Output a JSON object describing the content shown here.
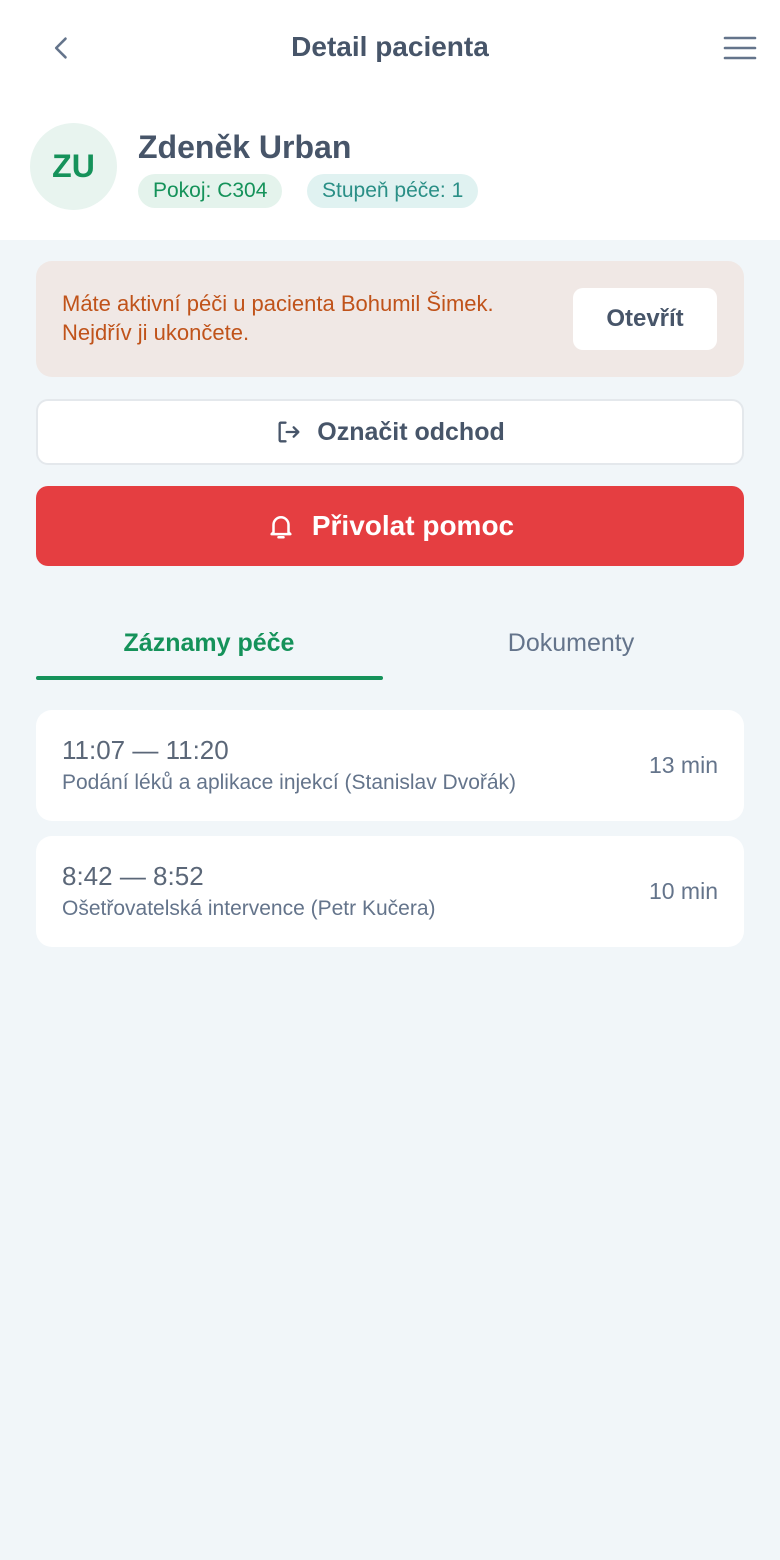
{
  "header": {
    "title": "Detail pacienta"
  },
  "patient": {
    "initials": "ZU",
    "name": "Zdeněk Urban",
    "room": "Pokoj: C304",
    "care_level": "Stupeň péče: 1"
  },
  "alert": {
    "message": "Máte aktivní péči u pacienta Bohumil Šimek. Nejdřív ji ukončete.",
    "button_label": "Otevřít"
  },
  "actions": {
    "mark_departure": "Označit odchod",
    "call_help": "Přivolat pomoc"
  },
  "tabs": [
    {
      "label": "Záznamy péče",
      "active": true
    },
    {
      "label": "Dokumenty",
      "active": false
    }
  ],
  "records": [
    {
      "time": "11:07 — 11:20",
      "description": "Podání léků a aplikace injekcí (Stanislav Dvořák)",
      "duration": "13 min"
    },
    {
      "time": "8:42 — 8:52",
      "description": "Ošetřovatelská intervence (Petr Kučera)",
      "duration": "10 min"
    }
  ],
  "icons": {
    "back": "chevron-left-icon",
    "menu": "hamburger-menu-icon",
    "mark": "logout-arrow-icon",
    "help": "bell-icon"
  },
  "colors": {
    "accent_green": "#15925a",
    "danger_red": "#e53e41",
    "alert_background": "#f0e8e5",
    "alert_text": "#c0531a",
    "page_background": "#f1f6f9"
  }
}
